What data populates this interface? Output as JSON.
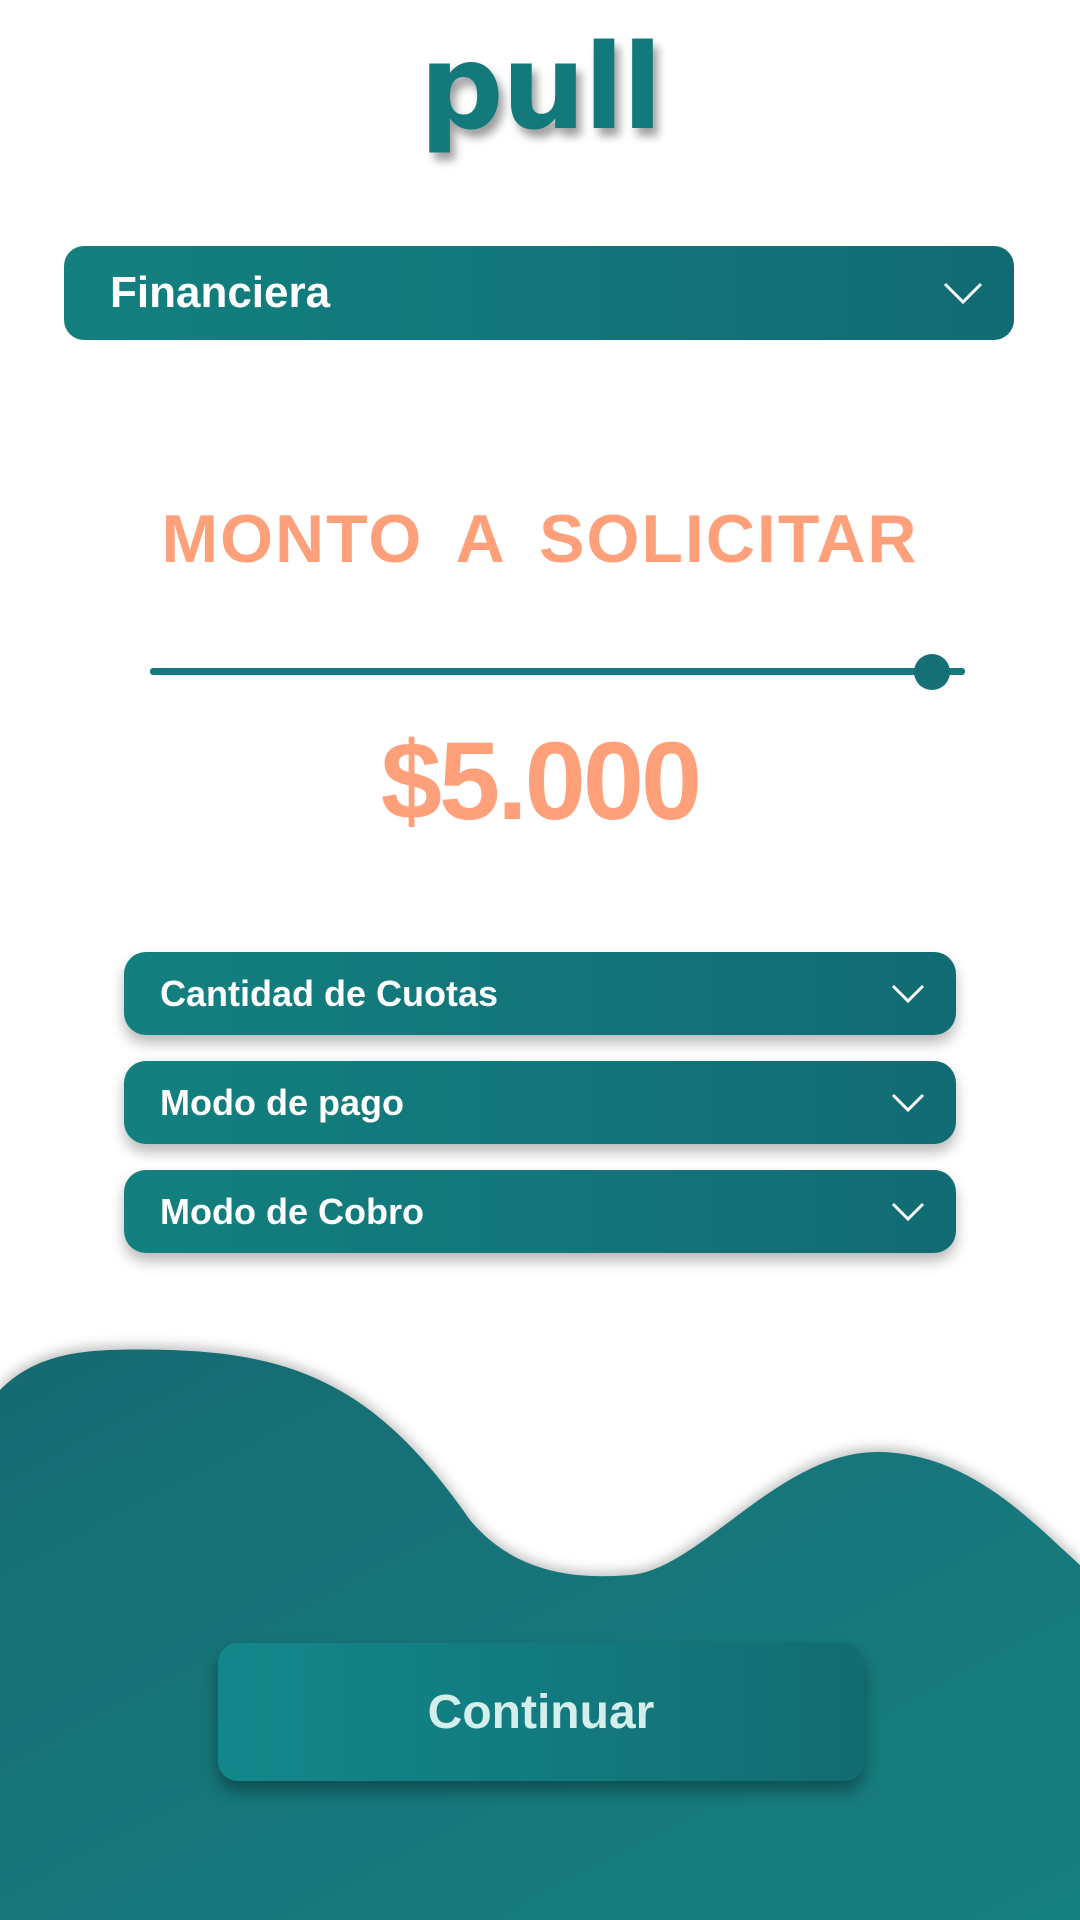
{
  "app": {
    "logo_text": "pull",
    "brand_color": "#137a7c",
    "accent_color": "#fea07a"
  },
  "entity_select": {
    "label": "Financiera",
    "icon": "chevron-down-icon"
  },
  "amount": {
    "title": "MONTO A SOLICITAR",
    "value_text": "$5.000",
    "slider_fraction": 0.96
  },
  "dropdowns": [
    {
      "label": "Cantidad de Cuotas",
      "icon": "chevron-down-icon"
    },
    {
      "label": "Modo de pago",
      "icon": "chevron-down-icon"
    },
    {
      "label": "Modo de Cobro",
      "icon": "chevron-down-icon"
    }
  ],
  "continue_button": {
    "label": "Continuar"
  }
}
